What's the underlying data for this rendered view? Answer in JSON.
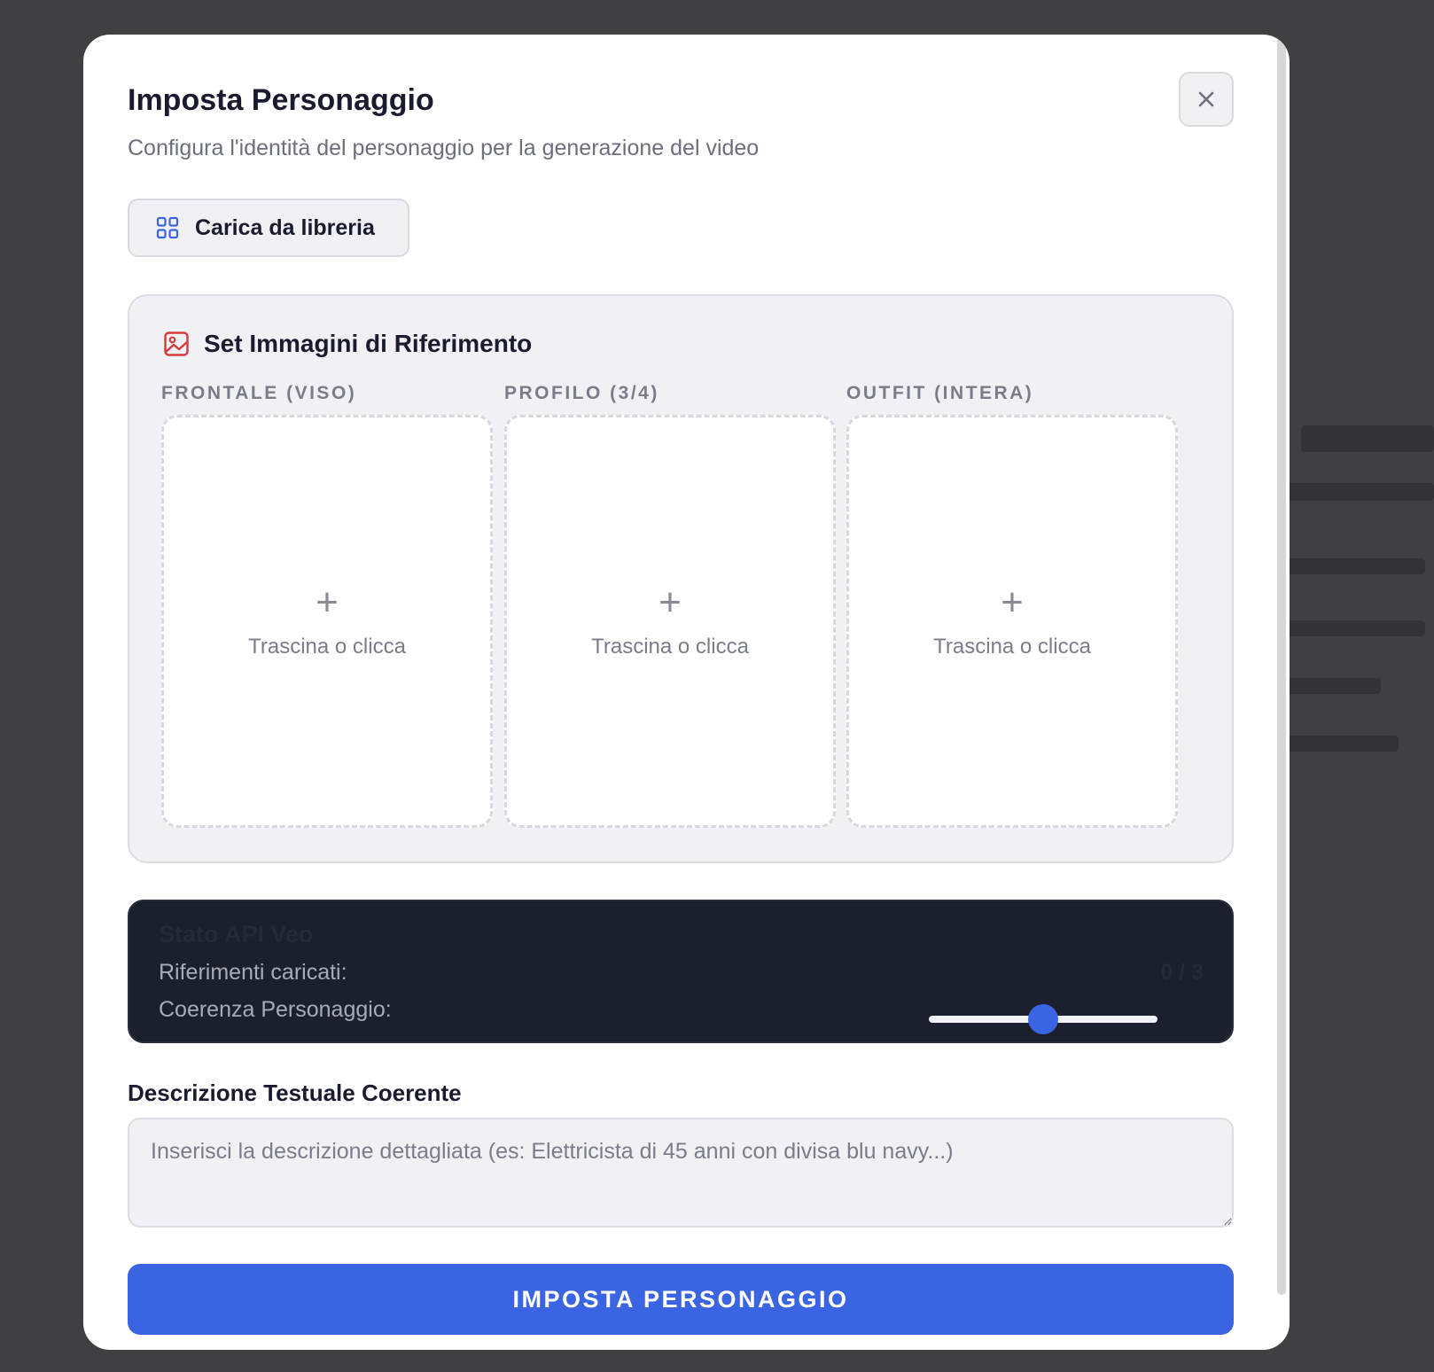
{
  "modal": {
    "title": "Imposta Personaggio",
    "subtitle": "Configura l'identità del personaggio per la generazione del video",
    "close_icon": "close-icon"
  },
  "library_button": {
    "label": "Carica da libreria",
    "icon": "grid-icon"
  },
  "reference_set": {
    "title": "Set Immagini di Riferimento",
    "icon": "image-icon",
    "slots": [
      {
        "label": "FRONTALE (VISO)",
        "hint": "Trascina o clicca"
      },
      {
        "label": "PROFILO (3/4)",
        "hint": "Trascina o clicca"
      },
      {
        "label": "OUTFIT (INTERA)",
        "hint": "Trascina o clicca"
      }
    ]
  },
  "status": {
    "title": "Stato API Veo",
    "references_label": "Riferimenti caricati:",
    "references_count": "0 / 3",
    "consistency_label": "Coerenza Personaggio:",
    "consistency_value": 0.5
  },
  "description": {
    "label": "Descrizione Testuale Coerente",
    "placeholder": "Inserisci la descrizione dettagliata (es: Elettricista di 45 anni con divisa blu navy...)",
    "value": ""
  },
  "submit_button": {
    "label": "IMPOSTA PERSONAGGIO"
  },
  "colors": {
    "accent": "#3b64e3",
    "panel_dark": "#1c1f2e",
    "icon_red": "#d63a3a"
  }
}
